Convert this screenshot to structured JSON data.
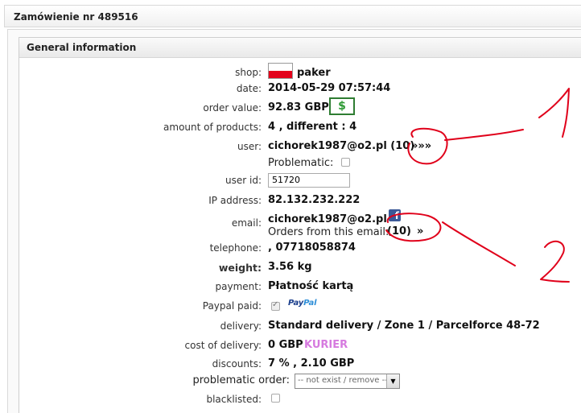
{
  "window": {
    "title": "Zamówienie nr 489516"
  },
  "panel": {
    "title": "General information"
  },
  "fields": {
    "shop": {
      "label": "shop:",
      "value": "paker"
    },
    "date": {
      "label": "date:",
      "value": "2014-05-29 07:57:44"
    },
    "order_value": {
      "label": "order value:",
      "value": "92.83 GBP",
      "badge": "$"
    },
    "amount": {
      "label": "amount of products:",
      "value": "4 , different : 4"
    },
    "user": {
      "label": "user:",
      "value": "cichorek1987@o2.pl (10)",
      "link": "»»»"
    },
    "problematic": {
      "label": "Problematic:",
      "checked": false
    },
    "user_id": {
      "label": "user id:",
      "value": "51720"
    },
    "ip": {
      "label": "IP address:",
      "value": "82.132.232.222"
    },
    "email": {
      "label": "email:",
      "value": "cichorek1987@o2.pl",
      "orders_label": "Orders from this email:",
      "orders_count": "(10)",
      "orders_link": "»",
      "fb": "f"
    },
    "telephone": {
      "label": "telephone:",
      "value": ", 07718058874"
    },
    "weight": {
      "label": "weight:",
      "value": "3.56 kg"
    },
    "payment": {
      "label": "payment:",
      "value": "Płatność kartą"
    },
    "paypal_paid": {
      "label": "Paypal paid:",
      "checked": true,
      "logo_a": "Pay",
      "logo_b": "Pal"
    },
    "delivery": {
      "label": "delivery:",
      "value": "Standard delivery / Zone 1 / Parcelforce 48-72"
    },
    "cost_delivery": {
      "label": "cost of delivery:",
      "value": "0 GBP",
      "tag": "KURIER"
    },
    "discounts": {
      "label": "discounts:",
      "value": "7 % , 2.10 GBP"
    },
    "problematic_order": {
      "label": "problematic order:",
      "selected": "-- not exist / remove --"
    },
    "blacklisted": {
      "label": "blacklisted:",
      "checked": false
    }
  },
  "annotations": {
    "one": "1",
    "two": "2",
    "color": "#e0001a"
  },
  "colors": {
    "flag_red": "#e3001b",
    "badge_green": "#2e9a35",
    "kurier": "#d67adf",
    "facebook": "#3b5998"
  }
}
